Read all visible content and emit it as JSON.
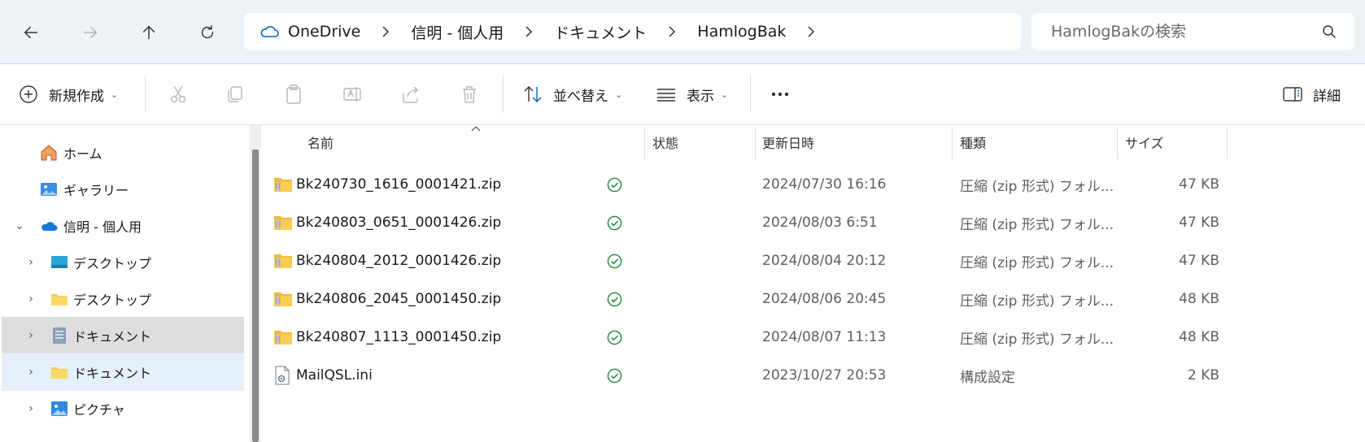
{
  "address_bar": {
    "crumbs": [
      "OneDrive",
      "信明 - 個人用",
      "ドキュメント",
      "HamlogBak"
    ],
    "search_placeholder": "HamlogBakの検索"
  },
  "toolbar": {
    "new_label": "新規作成",
    "sort_label": "並べ替え",
    "view_label": "表示",
    "details_label": "詳細"
  },
  "sidebar": {
    "items": [
      {
        "label": "ホーム",
        "icon": "home-icon"
      },
      {
        "label": "ギャラリー",
        "icon": "gallery-icon"
      },
      {
        "label": "信明 - 個人用",
        "icon": "onedrive-cloud-icon"
      },
      {
        "label": "デスクトップ",
        "icon": "desktop-icon"
      },
      {
        "label": "デスクトップ",
        "icon": "folder-icon"
      },
      {
        "label": "ドキュメント",
        "icon": "documents-icon"
      },
      {
        "label": "ドキュメント",
        "icon": "folder-icon"
      },
      {
        "label": "ピクチャ",
        "icon": "pictures-icon"
      }
    ]
  },
  "columns": {
    "name": "名前",
    "status": "状態",
    "modified": "更新日時",
    "type": "種類",
    "size": "サイズ"
  },
  "files": [
    {
      "name": "Bk240730_1616_0001421.zip",
      "modified": "2024/07/30 16:16",
      "type": "圧縮 (zip 形式) フォル...",
      "size": "47 KB",
      "icon": "zip-folder-icon"
    },
    {
      "name": "Bk240803_0651_0001426.zip",
      "modified": "2024/08/03 6:51",
      "type": "圧縮 (zip 形式) フォル...",
      "size": "47 KB",
      "icon": "zip-folder-icon"
    },
    {
      "name": "Bk240804_2012_0001426.zip",
      "modified": "2024/08/04 20:12",
      "type": "圧縮 (zip 形式) フォル...",
      "size": "47 KB",
      "icon": "zip-folder-icon"
    },
    {
      "name": "Bk240806_2045_0001450.zip",
      "modified": "2024/08/06 20:45",
      "type": "圧縮 (zip 形式) フォル...",
      "size": "48 KB",
      "icon": "zip-folder-icon"
    },
    {
      "name": "Bk240807_1113_0001450.zip",
      "modified": "2024/08/07 11:13",
      "type": "圧縮 (zip 形式) フォル...",
      "size": "48 KB",
      "icon": "zip-folder-icon"
    },
    {
      "name": "MailQSL.ini",
      "modified": "2023/10/27 20:53",
      "type": "構成設定",
      "size": "2 KB",
      "icon": "ini-file-icon"
    }
  ],
  "colors": {
    "sync_ok": "#1e8a3a",
    "accent": "#0067c0",
    "folder": "#f3c342",
    "selected_bg": "#e5f0fb",
    "hover_bg": "#dedede"
  }
}
